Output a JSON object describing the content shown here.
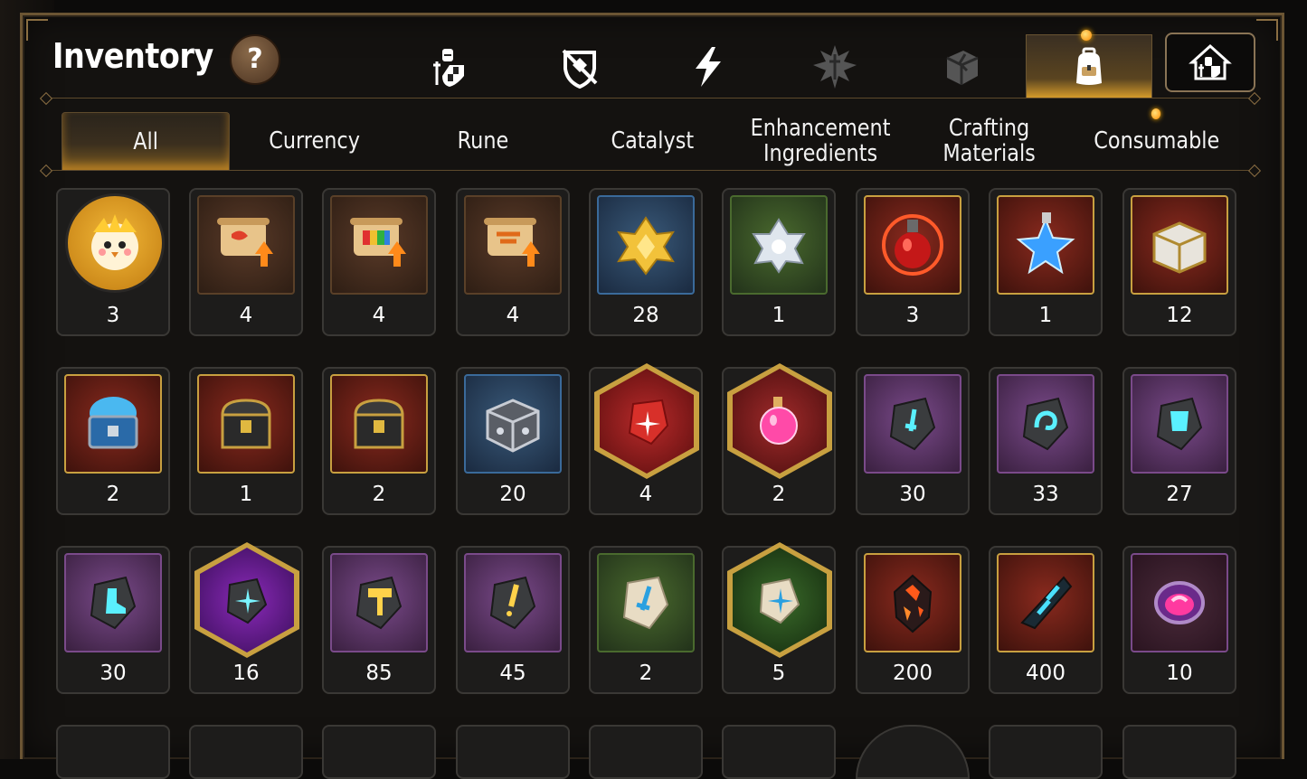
{
  "window": {
    "title": "Inventory",
    "help_icon": "?"
  },
  "category_tabs": [
    {
      "name": "knight-icon",
      "active": false
    },
    {
      "name": "broken-shield-icon",
      "active": false
    },
    {
      "name": "lightning-icon",
      "active": false
    },
    {
      "name": "burst-sword-icon",
      "active": false
    },
    {
      "name": "cube-icon",
      "active": false
    },
    {
      "name": "backpack-icon",
      "active": true,
      "notification": true
    },
    {
      "name": "house-knight-icon",
      "active": false
    }
  ],
  "sub_tabs": [
    {
      "label": "All",
      "active": true
    },
    {
      "label": "Currency"
    },
    {
      "label": "Rune"
    },
    {
      "label": "Catalyst"
    },
    {
      "label": "Enhancement\nIngredients"
    },
    {
      "label": "Crafting\nMaterials"
    },
    {
      "label": "Consumable",
      "notification": true
    }
  ],
  "items": [
    {
      "name": "chick-token",
      "count": "3"
    },
    {
      "name": "scroll-upgrade-red",
      "count": "4"
    },
    {
      "name": "scroll-upgrade-rainbow",
      "count": "4"
    },
    {
      "name": "scroll-upgrade-orange",
      "count": "4"
    },
    {
      "name": "gold-crystal-flower",
      "count": "28"
    },
    {
      "name": "silver-crystal-flower",
      "count": "1"
    },
    {
      "name": "fire-potion",
      "count": "3"
    },
    {
      "name": "star-potion",
      "count": "1"
    },
    {
      "name": "gold-chest",
      "count": "12"
    },
    {
      "name": "blue-mystic-chest",
      "count": "2"
    },
    {
      "name": "dark-treasure-chest",
      "count": "1"
    },
    {
      "name": "dark-treasure-chest",
      "count": "2"
    },
    {
      "name": "silver-cube",
      "count": "20"
    },
    {
      "name": "red-rune-stone",
      "count": "4"
    },
    {
      "name": "pink-potion",
      "count": "2"
    },
    {
      "name": "rune-sword",
      "count": "30"
    },
    {
      "name": "rune-swirl",
      "count": "33"
    },
    {
      "name": "rune-armor",
      "count": "27"
    },
    {
      "name": "rune-boot",
      "count": "30"
    },
    {
      "name": "rune-star-purple",
      "count": "16"
    },
    {
      "name": "rune-hammer",
      "count": "85"
    },
    {
      "name": "rune-bolt",
      "count": "45"
    },
    {
      "name": "stone-sword",
      "count": "2"
    },
    {
      "name": "stone-star",
      "count": "5"
    },
    {
      "name": "magma-shard",
      "count": "200"
    },
    {
      "name": "crystal-shard",
      "count": "400"
    },
    {
      "name": "pink-orb",
      "count": "10"
    }
  ],
  "colors": {
    "panel_border": "#6b5533",
    "tab_glow": "#d49a2a",
    "notification": "#ff8a00"
  }
}
